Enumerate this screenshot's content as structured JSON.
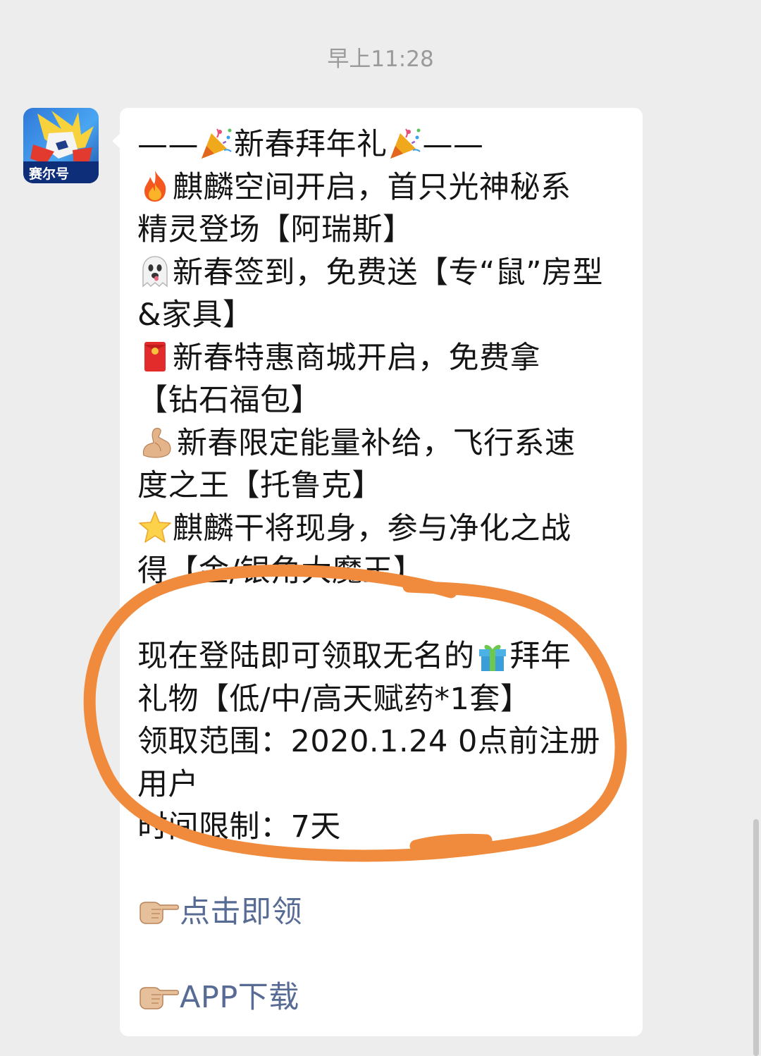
{
  "chat": {
    "timestamp": "早上11:28"
  },
  "sender": {
    "avatar_icon": "game-app-icon",
    "avatar_logo_text": "赛尔号"
  },
  "message": {
    "title_pre": "——",
    "title_main": "新春拜年礼",
    "title_post": "——",
    "item1_line1": "麒麟空间开启，首只光神秘系",
    "item1_line2": "精灵登场【阿瑞斯】",
    "item2_line1": "新春签到，免费送【专“鼠”房型",
    "item2_line2": "&家具】",
    "item3_line1": "新春特惠商城开启，免费拿",
    "item3_line2": "【钻石福包】",
    "item4_line1": "新春限定能量补给，飞行系速",
    "item4_line2": "度之王【托鲁克】",
    "item5_line1": "麒麟干将现身，参与净化之战",
    "item5_line2": "得【金/银角大魔王】",
    "gift_pre": "现在登陆即可领取无名的",
    "gift_post": "拜年",
    "gift_line2": "礼物【低/中/高天赋药*1套】",
    "range_line1": "领取范围：2020.1.24 0点前注册",
    "range_line2": "用户",
    "time_limit": "时间限制：7天",
    "link_claim": "点击即领",
    "link_app": "APP下载"
  },
  "icons": {
    "party": "party-popper-icon",
    "fire": "fire-icon",
    "ghost": "ghost-icon",
    "red_envelope": "red-envelope-icon",
    "muscle": "flexed-biceps-icon",
    "star": "star-icon",
    "gift": "gift-icon",
    "pointing": "pointing-hand-icon"
  },
  "colors": {
    "background": "#ededed",
    "bubble": "#ffffff",
    "link": "#576b95",
    "annotation_circle": "#f08a3c",
    "timestamp": "#9a9a9a"
  }
}
